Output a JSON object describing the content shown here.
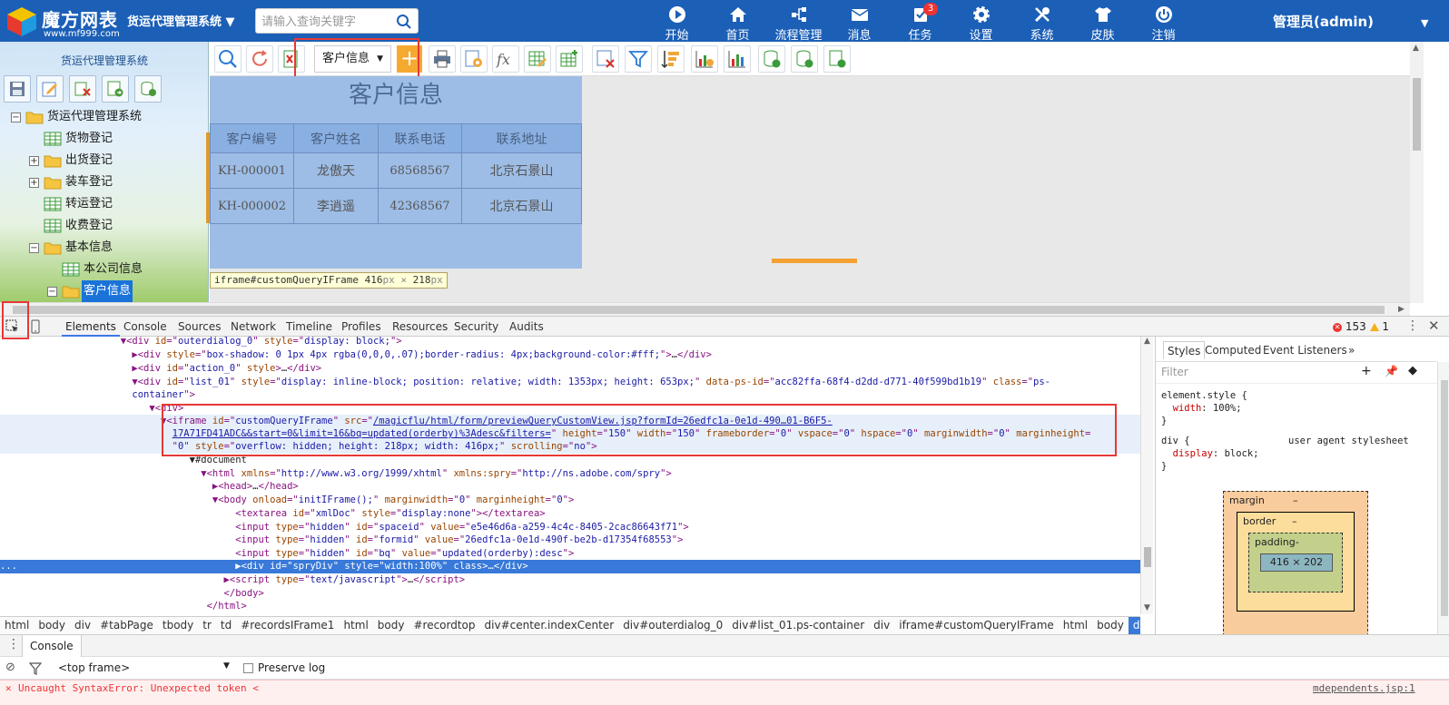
{
  "header": {
    "logo_name": "魔方网表",
    "logo_url": "www.mf999.com",
    "system_title": "货运代理管理系统",
    "search_placeholder": "请输入查询关键字",
    "nav": [
      {
        "label": "开始",
        "icon": "play-icon"
      },
      {
        "label": "首页",
        "icon": "home-icon"
      },
      {
        "label": "流程管理",
        "icon": "workflow-icon"
      },
      {
        "label": "消息",
        "icon": "mail-icon"
      },
      {
        "label": "任务",
        "icon": "task-icon",
        "badge": "3"
      },
      {
        "label": "设置",
        "icon": "gear-icon"
      },
      {
        "label": "系统",
        "icon": "tools-icon"
      },
      {
        "label": "皮肤",
        "icon": "shirt-icon"
      },
      {
        "label": "注销",
        "icon": "power-icon"
      }
    ],
    "user": "管理员(admin)"
  },
  "sidebar": {
    "title": "货运代理管理系统",
    "tools": [
      "save-icon",
      "edit-icon",
      "delete-icon",
      "export-icon",
      "database-icon"
    ],
    "tree": [
      {
        "label": "货运代理管理系统",
        "type": "folder",
        "expander": "−",
        "level": 0
      },
      {
        "label": "货物登记",
        "type": "table",
        "level": 1
      },
      {
        "label": "出货登记",
        "type": "folder",
        "expander": "+",
        "level": 1
      },
      {
        "label": "装车登记",
        "type": "folder",
        "expander": "+",
        "level": 1
      },
      {
        "label": "转运登记",
        "type": "table",
        "level": 1
      },
      {
        "label": "收费登记",
        "type": "table",
        "level": 1
      },
      {
        "label": "基本信息",
        "type": "folder",
        "expander": "−",
        "level": 1
      },
      {
        "label": "本公司信息",
        "type": "table",
        "level": 2
      },
      {
        "label": "客户信息",
        "type": "folder",
        "expander": "−",
        "level": 2,
        "selected": true
      }
    ]
  },
  "toolbar": {
    "select_value": "客户信息",
    "add_label": "+"
  },
  "preview": {
    "title": "客户信息",
    "columns": [
      "客户编号",
      "客户姓名",
      "联系电话",
      "联系地址"
    ],
    "rows": [
      [
        "KH-000001",
        "龙傲天",
        "68568567",
        "北京石景山"
      ],
      [
        "KH-000002",
        "李逍遥",
        "42368567",
        "北京石景山"
      ]
    ],
    "tooltip_selector": "iframe#customQueryIFrame",
    "tooltip_w": "416",
    "tooltip_h": "218",
    "tooltip_unit": "px",
    "tooltip_x": "×"
  },
  "devtools": {
    "tabs": [
      "Elements",
      "Console",
      "Sources",
      "Network",
      "Timeline",
      "Profiles",
      "Resources",
      "Security",
      "Audits"
    ],
    "active_tab": "Elements",
    "errors": "153",
    "warnings": "1",
    "breadcrumbs": [
      "html",
      "body",
      "div",
      "#tabPage",
      "tbody",
      "tr",
      "td",
      "#recordsIFrame1",
      "html",
      "body",
      "#recordtop",
      "div#center.indexCenter",
      "div#outerdialog_0",
      "div#list_01.ps-container",
      "div",
      "iframe#customQueryIFrame",
      "html",
      "body",
      "div#spryDiv"
    ],
    "styles_tabs": [
      "Styles",
      "Computed",
      "Event Listeners",
      "»"
    ],
    "filter_placeholder": "Filter",
    "rule1_selector": "element.style {",
    "rule1_prop": "width",
    "rule1_value": "100%;",
    "rule2_selector": "div {",
    "rule2_source": "user agent stylesheet",
    "rule2_prop": "display",
    "rule2_value": "block;",
    "close_brace": "}",
    "box_margin": "margin",
    "box_border": "border",
    "box_padding": "padding-",
    "box_content": "416 × 202",
    "dash": "–",
    "console_tab": "Console",
    "frame_select": "<top frame>",
    "preserve_log": "Preserve log",
    "error_text": "Uncaught SyntaxError: Unexpected token <",
    "error_source": "mdependents.jsp:1"
  },
  "colors": {
    "header_blue": "#1b5fb7",
    "highlight_red": "#e53935",
    "accent_orange": "#f6a92f",
    "devtools_selection": "#3879d9"
  }
}
